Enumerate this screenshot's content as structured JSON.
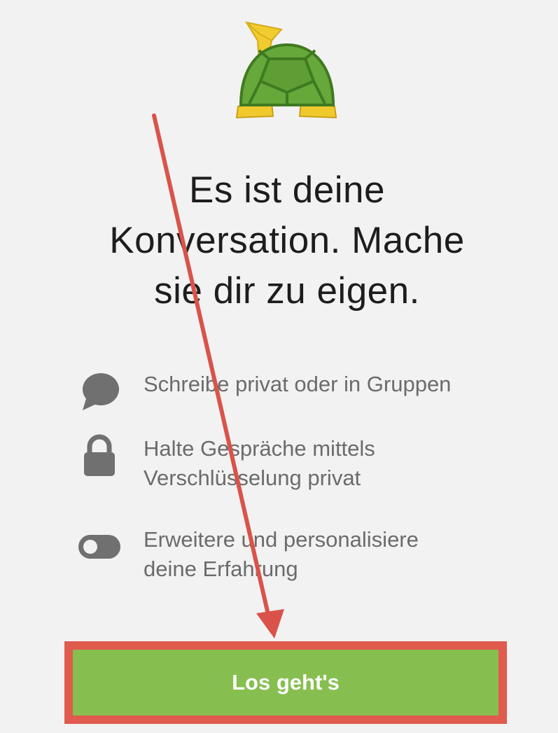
{
  "headline": {
    "line1": "Es ist deine",
    "line2": "Konversation. Mache",
    "line3": "sie dir zu eigen."
  },
  "features": [
    {
      "icon": "chat-bubble-icon",
      "line1": "Schreibe privat oder in Gruppen",
      "line2": ""
    },
    {
      "icon": "lock-icon",
      "line1": "Halte Gespräche mittels",
      "line2": "Verschlüsselung privat"
    },
    {
      "icon": "toggle-icon",
      "line1": "Erweitere und personalisiere",
      "line2": "deine Erfahrung"
    }
  ],
  "cta": {
    "label": "Los geht's"
  },
  "colors": {
    "accent": "#86bf4f",
    "annotation": "#e05a4e",
    "icon": "#707070",
    "background": "#f2f2f2"
  },
  "mascot": {
    "icon": "turtle-horn-icon"
  },
  "annotation_arrow": {
    "icon": "arrow-down-icon"
  }
}
